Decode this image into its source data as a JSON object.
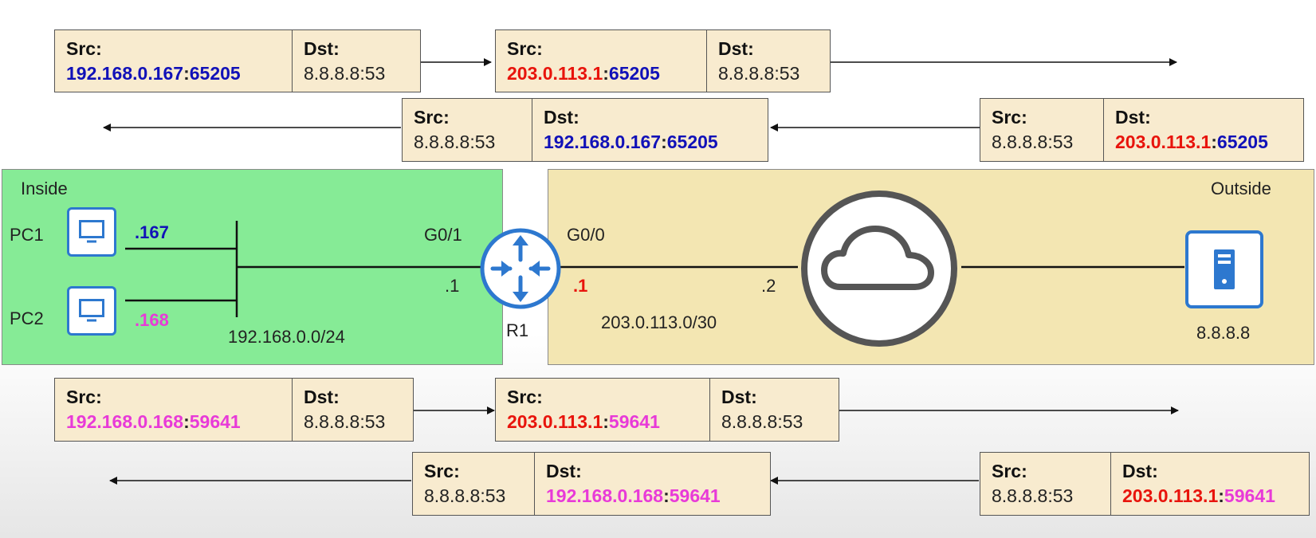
{
  "packets": [
    {
      "src_label": "Src",
      "dst_label": "Dst",
      "src": {
        "ip": "192.168.0.167",
        "port": "65205"
      },
      "dst": {
        "text": "8.8.8.8:53"
      }
    },
    {
      "src_label": "Src",
      "dst_label": "Dst",
      "src": {
        "ip": "203.0.113.1",
        "port": "65205"
      },
      "dst": {
        "text": "8.8.8.8:53"
      }
    },
    {
      "src_label": "Src",
      "dst_label": "Dst",
      "src": {
        "text": "8.8.8.8:53"
      },
      "dst": {
        "ip": "192.168.0.167",
        "port": "65205"
      }
    },
    {
      "src_label": "Src",
      "dst_label": "Dst",
      "src": {
        "text": "8.8.8.8:53"
      },
      "dst": {
        "ip": "203.0.113.1",
        "port": "65205"
      }
    },
    {
      "src_label": "Src",
      "dst_label": "Dst",
      "src": {
        "ip": "192.168.0.168",
        "port": "59641"
      },
      "dst": {
        "text": "8.8.8.8:53"
      }
    },
    {
      "src_label": "Src",
      "dst_label": "Dst",
      "src": {
        "ip": "203.0.113.1",
        "port": "59641"
      },
      "dst": {
        "text": "8.8.8.8:53"
      }
    },
    {
      "src_label": "Src",
      "dst_label": "Dst",
      "src": {
        "text": "8.8.8.8:53"
      },
      "dst": {
        "ip": "192.168.0.168",
        "port": "59641"
      }
    },
    {
      "src_label": "Src",
      "dst_label": "Dst",
      "src": {
        "text": "8.8.8.8:53"
      },
      "dst": {
        "ip": "203.0.113.1",
        "port": "59641"
      }
    }
  ],
  "zones": {
    "inside": "Inside",
    "outside": "Outside"
  },
  "devices": {
    "pc1": {
      "label": "PC1",
      "ip": ".167"
    },
    "pc2": {
      "label": "PC2",
      "ip": ".168"
    },
    "router": {
      "label": "R1",
      "inside_if": "G0/1",
      "inside_ip": ".1",
      "outside_if": "G0/0",
      "outside_ip": ".1"
    },
    "isp": {
      "ip": ".2"
    },
    "server": {
      "label": "8.8.8.8"
    }
  },
  "networks": {
    "inside": "192.168.0.0/24",
    "outside": "203.0.113.0/30"
  },
  "icons": {
    "pc": "pc-icon",
    "router": "router-icon",
    "cloud": "cloud-icon",
    "server": "server-icon"
  },
  "colors": {
    "pc1_flow": "#1111b8",
    "pc2_flow": "#e83ad8",
    "inside_global": "#e8140c",
    "inside_zone": "#86eb96",
    "outside_zone": "#f3e6b2",
    "packet_box": "#f8ebcf",
    "icon": "#2d78cf"
  }
}
